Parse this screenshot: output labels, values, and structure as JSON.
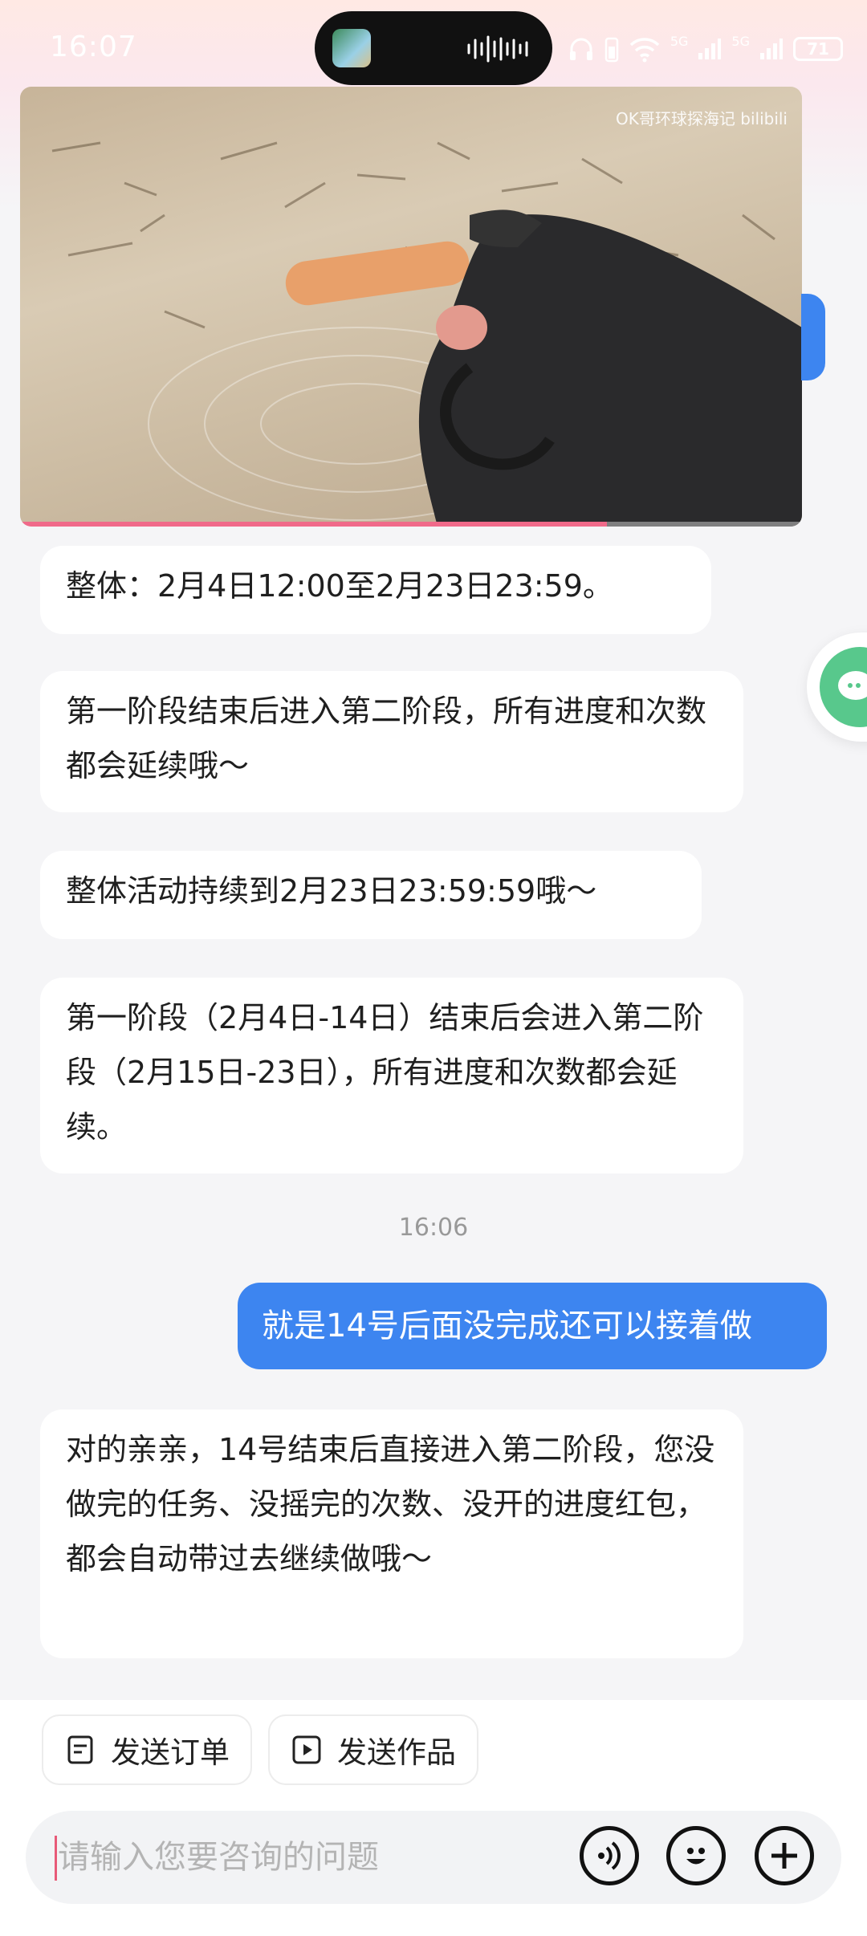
{
  "status_bar": {
    "time": "16:07",
    "network_1": "5G",
    "network_2": "5G",
    "battery": "71"
  },
  "video": {
    "watermark": "OK哥环球探海记 bilibili",
    "progress": 0.75
  },
  "messages": [
    {
      "side": "left",
      "text": "整体：2月4日12:00至2月23日23:59。"
    },
    {
      "side": "left",
      "text": "第一阶段结束后进入第二阶段，所有进度和次数都会延续哦～"
    },
    {
      "side": "left",
      "text": "整体活动持续到2月23日23:59:59哦～"
    },
    {
      "side": "left",
      "text": "第一阶段（2月4日-14日）结束后会进入第二阶段（2月15日-23日），所有进度和次数都会延续。"
    },
    {
      "side": "right",
      "text": "就是14号后面没完成还可以接着做"
    },
    {
      "side": "left",
      "text": "对的亲亲，14号结束后直接进入第二阶段，您没做完的任务、没摇完的次数、没开的进度红包，都会自动带过去继续做哦～"
    }
  ],
  "timestamp": "16:06",
  "quick_actions": {
    "send_order": "发送订单",
    "send_work": "发送作品"
  },
  "input": {
    "placeholder": "请输入您要咨询的问题"
  },
  "icons": {
    "voice": "voice-icon",
    "emoji": "emoji-icon",
    "plus": "plus-icon"
  },
  "colors": {
    "accent": "#3d85f0",
    "bubble_left": "#ffffff",
    "progress": "#f06a8a"
  }
}
